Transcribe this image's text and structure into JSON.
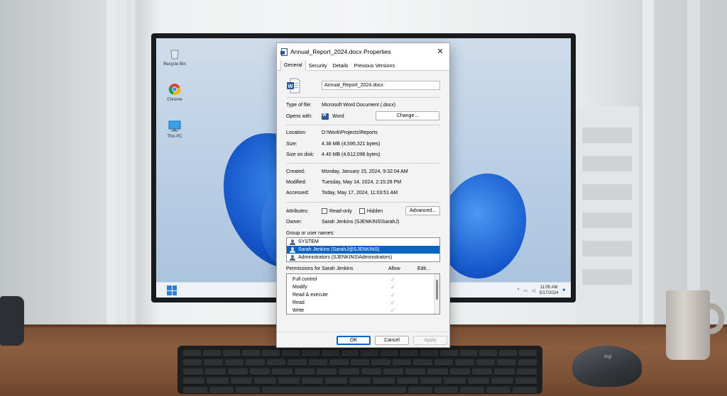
{
  "desktop": {
    "icons": [
      {
        "name": "recycle-bin-icon",
        "label": "Recycle Bin"
      },
      {
        "name": "chrome-icon",
        "label": "Chrome"
      },
      {
        "name": "this-pc-icon",
        "label": "This PC"
      }
    ],
    "taskbar": {
      "time": "11:05 AM",
      "date": "5/17/2024"
    }
  },
  "dialog": {
    "title": "Annual_Report_2024.docx Properties",
    "tabs": [
      "General",
      "Security",
      "Details",
      "Previous Versions"
    ],
    "active_tab": "General",
    "file_name": "Annual_Report_2024.docx",
    "type_label": "Type of file:",
    "type_value": "Microsoft Word Document (.docx)",
    "opens_label": "Opens with:",
    "opens_value": "Word",
    "change_button": "Change...",
    "location_label": "Location:",
    "location_value": "D:\\Work\\Projects\\Reports",
    "size_label": "Size:",
    "size_value": "4.38 MB (4,595,321 bytes)",
    "size_on_disk_label": "Size on disk:",
    "size_on_disk_value": "4.40 MB (4,612,096 bytes)",
    "created_label": "Created:",
    "created_value": "Monday, January 15, 2024, 9:32:04 AM",
    "modified_label": "Modified:",
    "modified_value": "Tuesday, May 14, 2024, 2:15:28 PM",
    "accessed_label": "Accessed:",
    "accessed_value": "Today, May 17, 2024, 11:03:51 AM",
    "attributes_label": "Attributes:",
    "readonly_label": "Read-only",
    "hidden_label": "Hidden",
    "advanced_button": "Advanced...",
    "owner_label": "Owner:",
    "owner_value": "Sarah Jenkins (SJENKINS\\SarahJ)",
    "group_label": "Group or user names:",
    "groups": [
      "SYSTEM",
      "Sarah Jenkins (SarahJ@SJENKINS)",
      "Administrators (SJENKINS\\Administrators)"
    ],
    "selected_group_index": 1,
    "permissions_label": "Permissions for Sarah Jenkins",
    "allow_label": "Allow",
    "edit_button": "Edit...",
    "permissions": [
      "Full control",
      "Modify",
      "Read & execute",
      "Read",
      "Write"
    ],
    "ok_button": "OK",
    "cancel_button": "Cancel",
    "apply_button": "Apply"
  },
  "colors": {
    "accent": "#0a64c2",
    "word_blue": "#2b5797",
    "wallpaper_bloom": "#1f6fe0"
  }
}
